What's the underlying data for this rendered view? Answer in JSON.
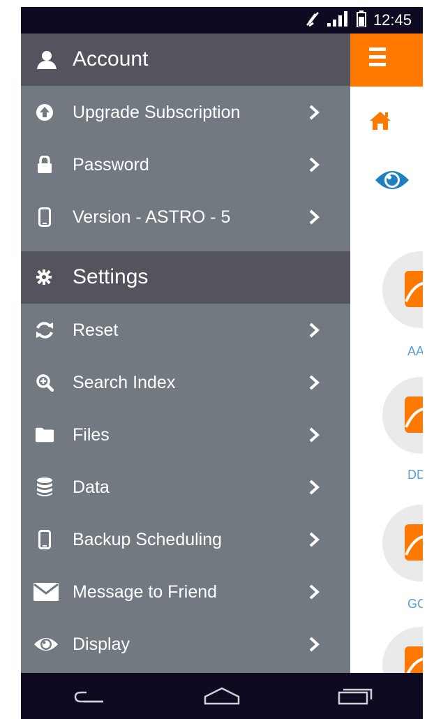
{
  "status_bar": {
    "time": "12:45",
    "icons": [
      "mute-icon",
      "signal-icon",
      "battery-icon"
    ]
  },
  "drawer": {
    "sections": [
      {
        "title": "Account",
        "icon": "user-icon",
        "items": [
          {
            "label": "Upgrade Subscription",
            "icon": "upload-circle-icon"
          },
          {
            "label": "Password",
            "icon": "lock-icon"
          },
          {
            "label": "Version - ASTRO - 5",
            "icon": "phone-icon"
          }
        ]
      },
      {
        "title": "Settings",
        "icon": "gear-icon",
        "items": [
          {
            "label": "Reset",
            "icon": "refresh-icon"
          },
          {
            "label": "Search Index",
            "icon": "zoom-in-icon"
          },
          {
            "label": "Files",
            "icon": "folder-icon"
          },
          {
            "label": "Data",
            "icon": "database-icon"
          },
          {
            "label": "Backup Scheduling",
            "icon": "phone-icon"
          },
          {
            "label": "Message to Friend",
            "icon": "envelope-icon"
          },
          {
            "label": "Display",
            "icon": "eye-icon"
          }
        ]
      }
    ]
  },
  "background_app": {
    "accent_color": "#ff7800",
    "labels": [
      "AA",
      "DD",
      "GC"
    ]
  },
  "nav_bar": {
    "buttons": [
      "back-icon",
      "home-icon",
      "recents-icon"
    ]
  },
  "colors": {
    "drawer_bg": "#727980",
    "section_bg": "#54545f",
    "status_bg": "#0d0a22",
    "accent": "#ff7800"
  }
}
